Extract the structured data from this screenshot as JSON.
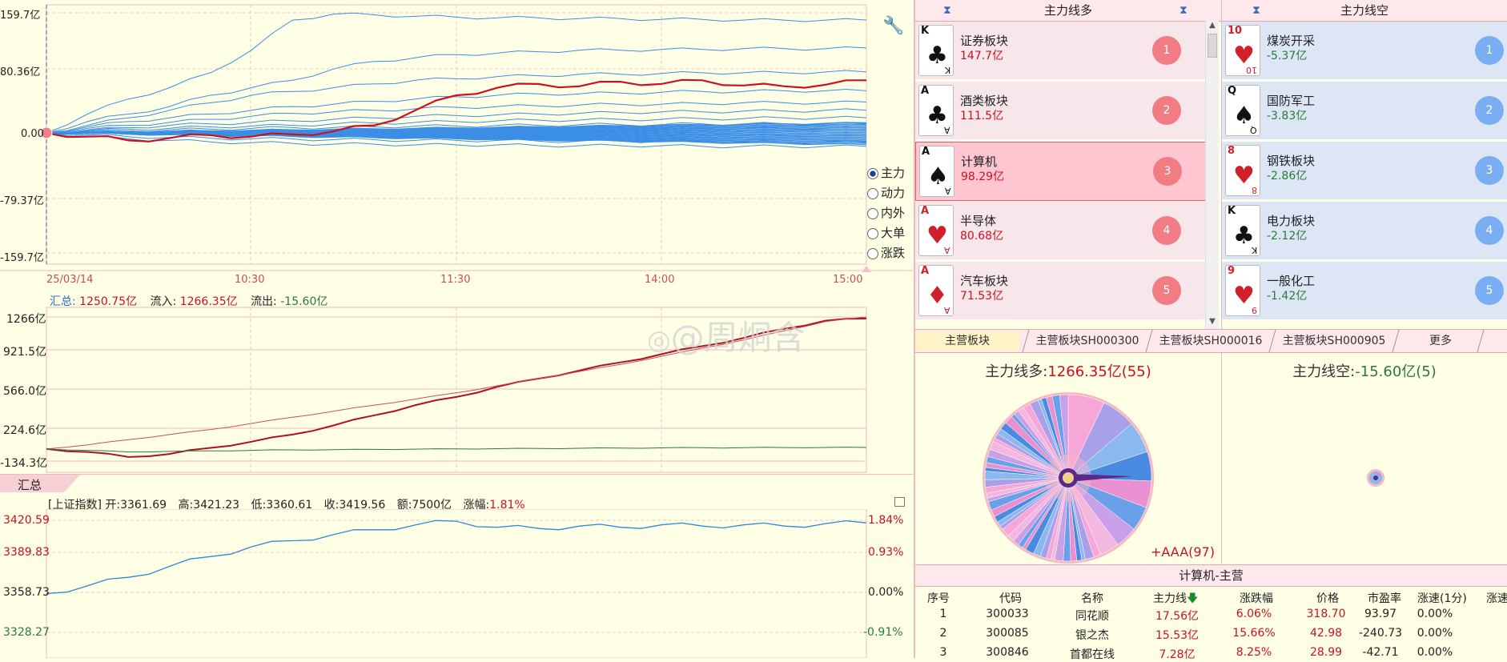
{
  "colors": {
    "bg": "#FFFFE6",
    "red": "#CC1020",
    "blue": "#3A8EE6",
    "green": "#2A7A3A",
    "pink_line": "#F2B8BE"
  },
  "top_chart": {
    "y_ticks": [
      "159.7亿",
      "80.36亿",
      "0.00",
      "-79.37亿",
      "-159.7亿"
    ],
    "x_ticks": [
      "25/03/14",
      "10:30",
      "11:30",
      "14:00",
      "15:00"
    ],
    "radio_options": [
      {
        "label": "主力",
        "checked": true
      },
      {
        "label": "动力",
        "checked": false
      },
      {
        "label": "内外",
        "checked": false
      },
      {
        "label": "大单",
        "checked": false
      },
      {
        "label": "涨跌",
        "checked": false
      }
    ]
  },
  "summary": {
    "total_label": "汇总:",
    "total_value": "1250.75亿",
    "in_label": "流入:",
    "in_value": "1266.35亿",
    "out_label": "流出:",
    "out_value": "-15.60亿",
    "tab": "汇总"
  },
  "mid_chart": {
    "y_ticks": [
      "1266亿",
      "921.5亿",
      "566.0亿",
      "224.6亿",
      "-134.3亿"
    ]
  },
  "index_bar": {
    "name": "[上证指数]",
    "open_label": "开:",
    "open": "3361.69",
    "high_label": "高:",
    "high": "3421.23",
    "low_label": "低:",
    "low": "3360.61",
    "close_label": "收:",
    "close": "3419.56",
    "amount_label": "额:",
    "amount": "7500亿",
    "change_label": "涨幅:",
    "change": "1.81%"
  },
  "index_chart": {
    "y_ticks_left": [
      "3420.59",
      "3389.83",
      "3358.73",
      "3328.27"
    ],
    "y_ticks_right": [
      "1.84%",
      "0.93%",
      "0.00%",
      "-0.91%"
    ]
  },
  "watermark": "@周炯含",
  "long_panel": {
    "title": "主力线多",
    "items": [
      {
        "rank": "1",
        "name": "证券板块",
        "value": "147.7亿",
        "card_rank": "K",
        "card_suit": "♣"
      },
      {
        "rank": "2",
        "name": "酒类板块",
        "value": "111.5亿",
        "card_rank": "A",
        "card_suit": "♣"
      },
      {
        "rank": "3",
        "name": "计算机",
        "value": "98.29亿",
        "card_rank": "A",
        "card_suit": "♠"
      },
      {
        "rank": "4",
        "name": "半导体",
        "value": "80.68亿",
        "card_rank": "A",
        "card_suit": "♥"
      },
      {
        "rank": "5",
        "name": "汽车板块",
        "value": "71.53亿",
        "card_rank": "A",
        "card_suit": "♦"
      }
    ]
  },
  "short_panel": {
    "title": "主力线空",
    "items": [
      {
        "rank": "1",
        "name": "煤炭开采",
        "value": "-5.37亿",
        "card_rank": "10",
        "card_suit": "♥"
      },
      {
        "rank": "2",
        "name": "国防军工",
        "value": "-3.83亿",
        "card_rank": "Q",
        "card_suit": "♠"
      },
      {
        "rank": "3",
        "name": "钢铁板块",
        "value": "-2.86亿",
        "card_rank": "8",
        "card_suit": "♥"
      },
      {
        "rank": "4",
        "name": "电力板块",
        "value": "-2.12亿",
        "card_rank": "K",
        "card_suit": "♣"
      },
      {
        "rank": "5",
        "name": "一般化工",
        "value": "-1.42亿",
        "card_rank": "9",
        "card_suit": "♥"
      }
    ]
  },
  "tabs": [
    "主营板块",
    "主营板块SH000300",
    "主营板块SH000016",
    "主营板块SH000905",
    "更多"
  ],
  "pie_long": {
    "label": "主力线多:",
    "value": "1266.35亿(55)",
    "footer": "+AAA(97)"
  },
  "pie_short": {
    "label": "主力线空:",
    "value": "-15.60亿(5)"
  },
  "table": {
    "title": "计算机-主营",
    "headers": [
      "序号",
      "代码",
      "名称",
      "主力线",
      "涨跌幅",
      "价格",
      "市盈率",
      "涨速(1分)",
      "涨速"
    ],
    "rows": [
      {
        "no": "1",
        "code": "300033",
        "name": "同花顺",
        "flow": "17.56亿",
        "chg": "6.06%",
        "price": "318.70",
        "pe": "93.97",
        "speed": "0.00%"
      },
      {
        "no": "2",
        "code": "300085",
        "name": "银之杰",
        "flow": "15.53亿",
        "chg": "15.66%",
        "price": "42.98",
        "pe": "-240.73",
        "speed": "0.00%"
      },
      {
        "no": "3",
        "code": "300846",
        "name": "首都在线",
        "flow": "7.28亿",
        "chg": "8.25%",
        "price": "28.99",
        "pe": "-42.71",
        "speed": "0.00%"
      }
    ]
  },
  "chart_data": [
    {
      "type": "line",
      "title": "",
      "x_labels": [
        "25/03/14",
        "10:30",
        "11:30",
        "14:00",
        "15:00"
      ],
      "ylim": [
        -159.7,
        159.7
      ],
      "series": [
        {
          "role": "highlight",
          "values": [
            0,
            -5,
            -10,
            -7,
            -3,
            -5,
            -2,
            2,
            10,
            30,
            50,
            60,
            65,
            62,
            68,
            65,
            70,
            63,
            62,
            64,
            70
          ]
        },
        {
          "role": "top",
          "values": [
            0,
            25,
            45,
            60,
            80,
            110,
            150,
            158,
            157,
            155,
            154,
            153,
            153,
            152,
            152,
            151,
            151,
            150,
            150,
            150,
            150
          ]
        },
        {
          "role": "other",
          "values": [
            0,
            15,
            25,
            35,
            50,
            60,
            70,
            85,
            95,
            100,
            104,
            106,
            108,
            110,
            110,
            111,
            111,
            112,
            112,
            112,
            113
          ]
        },
        {
          "role": "other",
          "values": [
            0,
            10,
            20,
            30,
            40,
            50,
            55,
            60,
            65,
            70,
            72,
            75,
            76,
            78,
            78,
            79,
            80,
            80,
            80,
            81,
            81
          ]
        },
        {
          "role": "other",
          "values": [
            0,
            8,
            15,
            20,
            25,
            30,
            35,
            38,
            42,
            45,
            48,
            50,
            52,
            52,
            53,
            54,
            55,
            55,
            56,
            56,
            56
          ]
        },
        {
          "role": "other",
          "values": [
            0,
            6,
            10,
            14,
            18,
            22,
            26,
            28,
            30,
            32,
            34,
            35,
            36,
            37,
            38,
            38,
            39,
            40,
            40,
            40,
            41
          ]
        },
        {
          "role": "other",
          "values": [
            0,
            4,
            7,
            10,
            12,
            14,
            16,
            18,
            20,
            22,
            23,
            24,
            25,
            26,
            27,
            28,
            28,
            29,
            29,
            30,
            30
          ]
        },
        {
          "role": "other",
          "values": [
            0,
            3,
            5,
            6,
            8,
            9,
            10,
            12,
            13,
            14,
            15,
            16,
            17,
            17,
            18,
            18,
            19,
            19,
            20,
            20,
            20
          ]
        },
        {
          "role": "other",
          "values": [
            0,
            2,
            3,
            4,
            5,
            6,
            7,
            7,
            8,
            9,
            9,
            10,
            10,
            11,
            11,
            11,
            12,
            12,
            12,
            12,
            12
          ]
        },
        {
          "role": "other",
          "values": [
            0,
            1,
            1,
            2,
            2,
            3,
            3,
            4,
            4,
            4,
            5,
            5,
            5,
            5,
            6,
            6,
            6,
            6,
            6,
            6,
            6
          ]
        },
        {
          "role": "other",
          "values": [
            0,
            -3,
            -5,
            -6,
            -7,
            -8,
            -8,
            -9,
            -9,
            -10,
            -10,
            -10,
            -11,
            -11,
            -11,
            -11,
            -12,
            -12,
            -12,
            -12,
            -12
          ]
        },
        {
          "role": "other",
          "values": [
            0,
            -5,
            -8,
            -10,
            -12,
            -13,
            -14,
            -15,
            -15,
            -16,
            -16,
            -16,
            -17,
            -17,
            -17,
            -17,
            -18,
            -18,
            -18,
            -18,
            -18
          ]
        }
      ]
    },
    {
      "type": "line",
      "title": "",
      "ylim": [
        -134.3,
        1266
      ],
      "series": [
        {
          "name": "汇总",
          "values": [
            -30,
            -60,
            -110,
            -80,
            -20,
            40,
            110,
            200,
            300,
            400,
            480,
            580,
            660,
            740,
            820,
            900,
            980,
            1060,
            1150,
            1230,
            1251
          ]
        },
        {
          "name": "流入",
          "values": [
            -30,
            10,
            60,
            110,
            160,
            220,
            280,
            340,
            400,
            460,
            520,
            590,
            660,
            730,
            800,
            880,
            960,
            1040,
            1130,
            1220,
            1266
          ]
        },
        {
          "name": "流出",
          "values": [
            -30,
            -45,
            -60,
            -55,
            -50,
            -45,
            -40,
            -38,
            -35,
            -33,
            -30,
            -28,
            -26,
            -24,
            -22,
            -20,
            -19,
            -18,
            -17,
            -16,
            -16
          ]
        }
      ]
    },
    {
      "type": "line",
      "title": "上证指数",
      "ylim": [
        3320,
        3425
      ],
      "series": [
        {
          "name": "上证指数",
          "values": [
            3361.7,
            3368,
            3375,
            3384,
            3392,
            3400,
            3405,
            3410,
            3414,
            3418,
            3421,
            3416,
            3415,
            3417,
            3416,
            3418,
            3417,
            3418,
            3417,
            3419,
            3419.6
          ]
        }
      ]
    },
    {
      "type": "pie",
      "title": "主力线多",
      "categories": [
        "证券板块",
        "酒类板块",
        "计算机",
        "半导体",
        "汽车板块"
      ],
      "values": [
        147.7,
        111.5,
        98.29,
        80.68,
        71.53
      ]
    },
    {
      "type": "pie",
      "title": "主力线空",
      "categories": [
        "煤炭开采",
        "国防军工",
        "钢铁板块",
        "电力板块",
        "一般化工"
      ],
      "values": [
        5.37,
        3.83,
        2.86,
        2.12,
        1.42
      ]
    }
  ]
}
